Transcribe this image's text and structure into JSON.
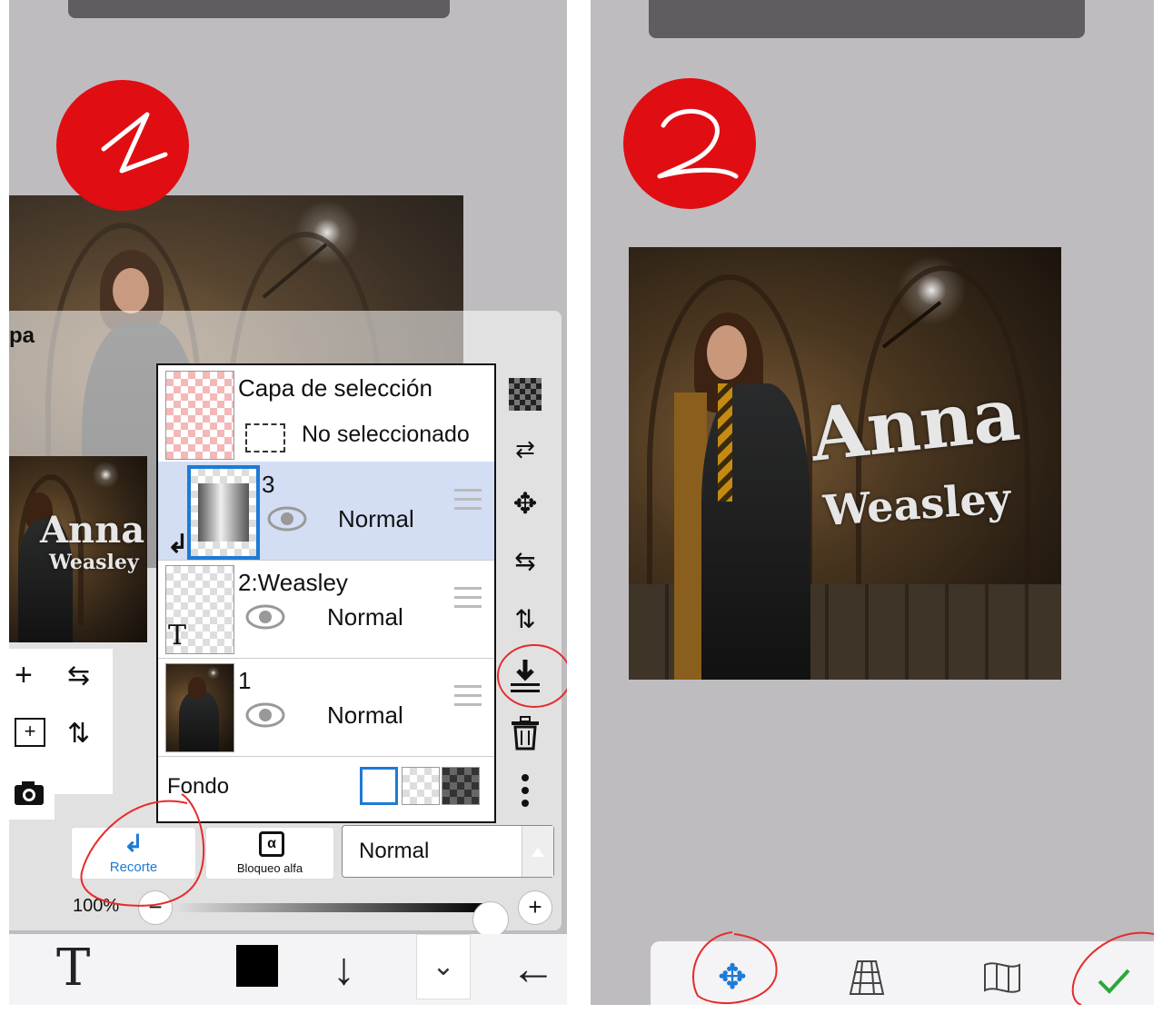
{
  "panel1": {
    "badge_number": "1",
    "layer_window_title": "pa",
    "layers": [
      {
        "name": "Capa de selección",
        "status": "No seleccionado"
      },
      {
        "name": "3",
        "blend": "Normal"
      },
      {
        "name": "2:Weasley",
        "blend": "Normal"
      },
      {
        "name": "1",
        "blend": "Normal"
      }
    ],
    "background_label": "Fondo",
    "ops": {
      "clipping": "Recorte",
      "alpha_lock": "Bloqueo alfa",
      "alpha_symbol": "α",
      "blend_mode": "Normal"
    },
    "opacity": "100%",
    "opacity_value": 1.0,
    "thumb_text": {
      "line1": "Anna",
      "line2": "Weasley"
    }
  },
  "panel2": {
    "badge_number": "2",
    "title": {
      "line1": "Anna",
      "line2": "Weasley"
    }
  },
  "icons": {
    "left_tools": [
      "plus-icon",
      "flip-horizontal-icon",
      "add-layer-icon",
      "flip-vertical-icon",
      "camera-icon"
    ],
    "right_tools": [
      "transparency-icon",
      "swap-icon",
      "move-icon",
      "flip-horizontal-icon",
      "flip-vertical-icon",
      "merge-down-icon",
      "trash-icon",
      "more-icon"
    ],
    "bottom_bar1": [
      "text-icon",
      "color-swatch",
      "arrow-down-icon",
      "collapse-icon",
      "back-icon"
    ],
    "bottom_bar2": [
      "move-icon",
      "perspective-icon",
      "warp-icon",
      "check-icon"
    ]
  },
  "colors": {
    "badge": "#e00d12",
    "accent": "#1e7ad6",
    "confirm": "#2aa83a",
    "selected_row": "#d3def4"
  }
}
